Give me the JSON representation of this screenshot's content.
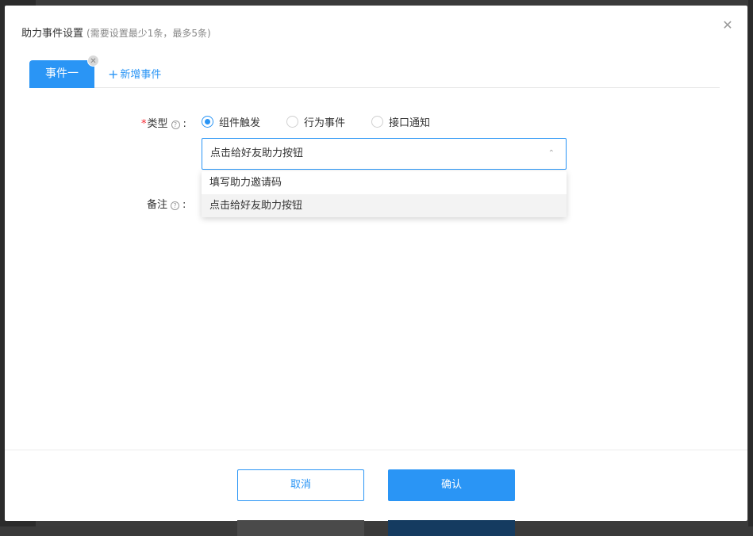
{
  "modal": {
    "title": "助力事件设置",
    "subtitle": "(需要设置最少1条，最多5条)",
    "close_icon": "close-icon"
  },
  "tabs": {
    "active_label": "事件一",
    "add_label": "新增事件"
  },
  "form": {
    "type_label": "类型",
    "remark_label": "备注",
    "radio_options": [
      "组件触发",
      "行为事件",
      "接口通知"
    ],
    "selected_radio": "组件触发",
    "select_value": "点击给好友助力按钮",
    "dropdown_options": [
      "填写助力邀请码",
      "点击给好友助力按钮"
    ]
  },
  "footer": {
    "cancel_label": "取消",
    "confirm_label": "确认"
  },
  "colors": {
    "accent": "#2a95f5",
    "required": "#f5222d"
  }
}
